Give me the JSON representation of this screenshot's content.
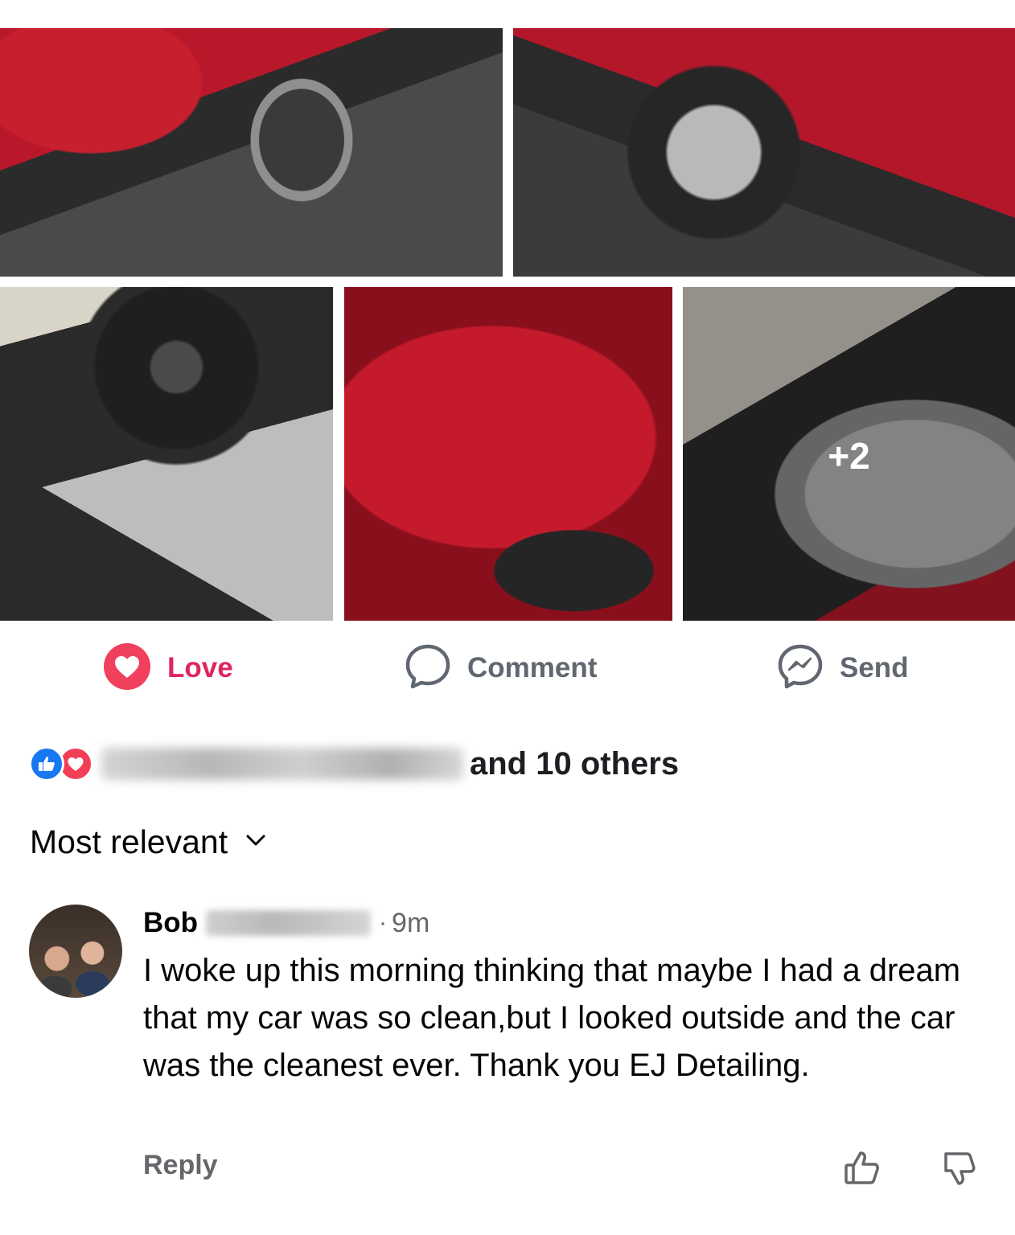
{
  "gallery": {
    "more_count": "+2"
  },
  "actions": {
    "love_label": "Love",
    "comment_label": "Comment",
    "send_label": "Send"
  },
  "reactions": {
    "summary_suffix": "and 10 others"
  },
  "sort": {
    "label": "Most relevant"
  },
  "comment": {
    "author_first_name": "Bob",
    "separator": "·",
    "time": "9m",
    "text": "I woke up this morning thinking that maybe I had a dream that my car was so clean,but I looked outside and the car was the cleanest ever. Thank you EJ Detailing.",
    "reply_label": "Reply"
  },
  "colors": {
    "love_red": "#e0245e",
    "like_blue": "#1877f2",
    "secondary_text": "#65676b"
  }
}
